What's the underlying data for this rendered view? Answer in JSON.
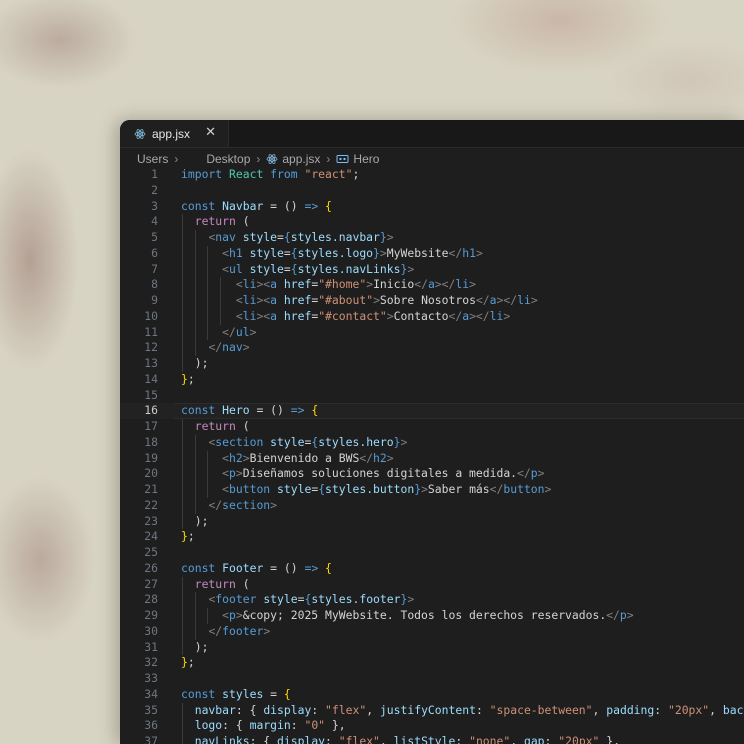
{
  "tab": {
    "filename": "app.jsx",
    "close_glyph": "✕"
  },
  "breadcrumb": [
    "Users",
    "Desktop",
    "app.jsx",
    "Hero"
  ],
  "active_line": 16,
  "colors": {
    "editor_bg": "#1e1e1e",
    "keyword": "#c586c0",
    "declaration": "#569cd6",
    "string": "#ce9178",
    "identifier": "#9cdcfe",
    "tag": "#569cd6",
    "bracket": "#ffd700"
  },
  "icons": {
    "tab": "react-icon",
    "breadcrumb_file": "react-icon",
    "breadcrumb_symbol": "symbol-variable-icon"
  },
  "lines": [
    [
      [
        "kw2",
        "import"
      ],
      [
        "plain",
        " "
      ],
      [
        "cls",
        "React"
      ],
      [
        "plain",
        " "
      ],
      [
        "kw2",
        "from"
      ],
      [
        "plain",
        " "
      ],
      [
        "str",
        "\"react\""
      ],
      [
        "plain",
        ";"
      ]
    ],
    [],
    [
      [
        "kw2",
        "const"
      ],
      [
        "plain",
        " "
      ],
      [
        "id",
        "Navbar"
      ],
      [
        "plain",
        " = () "
      ],
      [
        "kw2",
        "=>"
      ],
      [
        "plain",
        " "
      ],
      [
        "brace",
        "{"
      ]
    ],
    [
      [
        "plain",
        "  "
      ],
      [
        "kw",
        "return"
      ],
      [
        "plain",
        " ("
      ]
    ],
    [
      [
        "plain",
        "    "
      ],
      [
        "punc",
        "<"
      ],
      [
        "tag",
        "nav"
      ],
      [
        "plain",
        " "
      ],
      [
        "attr",
        "style"
      ],
      [
        "plain",
        "="
      ],
      [
        "kw2",
        "{"
      ],
      [
        "id",
        "styles.navbar"
      ],
      [
        "kw2",
        "}"
      ],
      [
        "punc",
        ">"
      ]
    ],
    [
      [
        "plain",
        "      "
      ],
      [
        "punc",
        "<"
      ],
      [
        "tag",
        "h1"
      ],
      [
        "plain",
        " "
      ],
      [
        "attr",
        "style"
      ],
      [
        "plain",
        "="
      ],
      [
        "kw2",
        "{"
      ],
      [
        "id",
        "styles.logo"
      ],
      [
        "kw2",
        "}"
      ],
      [
        "punc",
        ">"
      ],
      [
        "plain",
        "MyWebsite"
      ],
      [
        "punc",
        "</"
      ],
      [
        "tag",
        "h1"
      ],
      [
        "punc",
        ">"
      ]
    ],
    [
      [
        "plain",
        "      "
      ],
      [
        "punc",
        "<"
      ],
      [
        "tag",
        "ul"
      ],
      [
        "plain",
        " "
      ],
      [
        "attr",
        "style"
      ],
      [
        "plain",
        "="
      ],
      [
        "kw2",
        "{"
      ],
      [
        "id",
        "styles.navLinks"
      ],
      [
        "kw2",
        "}"
      ],
      [
        "punc",
        ">"
      ]
    ],
    [
      [
        "plain",
        "        "
      ],
      [
        "punc",
        "<"
      ],
      [
        "tag",
        "li"
      ],
      [
        "punc",
        "><"
      ],
      [
        "tag",
        "a"
      ],
      [
        "plain",
        " "
      ],
      [
        "attr",
        "href"
      ],
      [
        "plain",
        "="
      ],
      [
        "str",
        "\"#home\""
      ],
      [
        "punc",
        ">"
      ],
      [
        "plain",
        "Inicio"
      ],
      [
        "punc",
        "</"
      ],
      [
        "tag",
        "a"
      ],
      [
        "punc",
        "></"
      ],
      [
        "tag",
        "li"
      ],
      [
        "punc",
        ">"
      ]
    ],
    [
      [
        "plain",
        "        "
      ],
      [
        "punc",
        "<"
      ],
      [
        "tag",
        "li"
      ],
      [
        "punc",
        "><"
      ],
      [
        "tag",
        "a"
      ],
      [
        "plain",
        " "
      ],
      [
        "attr",
        "href"
      ],
      [
        "plain",
        "="
      ],
      [
        "str",
        "\"#about\""
      ],
      [
        "punc",
        ">"
      ],
      [
        "plain",
        "Sobre Nosotros"
      ],
      [
        "punc",
        "</"
      ],
      [
        "tag",
        "a"
      ],
      [
        "punc",
        "></"
      ],
      [
        "tag",
        "li"
      ],
      [
        "punc",
        ">"
      ]
    ],
    [
      [
        "plain",
        "        "
      ],
      [
        "punc",
        "<"
      ],
      [
        "tag",
        "li"
      ],
      [
        "punc",
        "><"
      ],
      [
        "tag",
        "a"
      ],
      [
        "plain",
        " "
      ],
      [
        "attr",
        "href"
      ],
      [
        "plain",
        "="
      ],
      [
        "str",
        "\"#contact\""
      ],
      [
        "punc",
        ">"
      ],
      [
        "plain",
        "Contacto"
      ],
      [
        "punc",
        "</"
      ],
      [
        "tag",
        "a"
      ],
      [
        "punc",
        "></"
      ],
      [
        "tag",
        "li"
      ],
      [
        "punc",
        ">"
      ]
    ],
    [
      [
        "plain",
        "      "
      ],
      [
        "punc",
        "</"
      ],
      [
        "tag",
        "ul"
      ],
      [
        "punc",
        ">"
      ]
    ],
    [
      [
        "plain",
        "    "
      ],
      [
        "punc",
        "</"
      ],
      [
        "tag",
        "nav"
      ],
      [
        "punc",
        ">"
      ]
    ],
    [
      [
        "plain",
        "  );"
      ]
    ],
    [
      [
        "brace",
        "}"
      ],
      [
        "plain",
        ";"
      ]
    ],
    [],
    [
      [
        "kw2",
        "const"
      ],
      [
        "plain",
        " "
      ],
      [
        "id",
        "Hero"
      ],
      [
        "plain",
        " = () "
      ],
      [
        "kw2",
        "=>"
      ],
      [
        "plain",
        " "
      ],
      [
        "brace",
        "{"
      ]
    ],
    [
      [
        "plain",
        "  "
      ],
      [
        "kw",
        "return"
      ],
      [
        "plain",
        " ("
      ]
    ],
    [
      [
        "plain",
        "    "
      ],
      [
        "punc",
        "<"
      ],
      [
        "tag",
        "section"
      ],
      [
        "plain",
        " "
      ],
      [
        "attr",
        "style"
      ],
      [
        "plain",
        "="
      ],
      [
        "kw2",
        "{"
      ],
      [
        "id",
        "styles.hero"
      ],
      [
        "kw2",
        "}"
      ],
      [
        "punc",
        ">"
      ]
    ],
    [
      [
        "plain",
        "      "
      ],
      [
        "punc",
        "<"
      ],
      [
        "tag",
        "h2"
      ],
      [
        "punc",
        ">"
      ],
      [
        "plain",
        "Bienvenido a BWS"
      ],
      [
        "punc",
        "</"
      ],
      [
        "tag",
        "h2"
      ],
      [
        "punc",
        ">"
      ]
    ],
    [
      [
        "plain",
        "      "
      ],
      [
        "punc",
        "<"
      ],
      [
        "tag",
        "p"
      ],
      [
        "punc",
        ">"
      ],
      [
        "plain",
        "Diseñamos soluciones digitales a medida."
      ],
      [
        "punc",
        "</"
      ],
      [
        "tag",
        "p"
      ],
      [
        "punc",
        ">"
      ]
    ],
    [
      [
        "plain",
        "      "
      ],
      [
        "punc",
        "<"
      ],
      [
        "tag",
        "button"
      ],
      [
        "plain",
        " "
      ],
      [
        "attr",
        "style"
      ],
      [
        "plain",
        "="
      ],
      [
        "kw2",
        "{"
      ],
      [
        "id",
        "styles.button"
      ],
      [
        "kw2",
        "}"
      ],
      [
        "punc",
        ">"
      ],
      [
        "plain",
        "Saber más"
      ],
      [
        "punc",
        "</"
      ],
      [
        "tag",
        "button"
      ],
      [
        "punc",
        ">"
      ]
    ],
    [
      [
        "plain",
        "    "
      ],
      [
        "punc",
        "</"
      ],
      [
        "tag",
        "section"
      ],
      [
        "punc",
        ">"
      ]
    ],
    [
      [
        "plain",
        "  );"
      ]
    ],
    [
      [
        "brace",
        "}"
      ],
      [
        "plain",
        ";"
      ]
    ],
    [],
    [
      [
        "kw2",
        "const"
      ],
      [
        "plain",
        " "
      ],
      [
        "id",
        "Footer"
      ],
      [
        "plain",
        " = () "
      ],
      [
        "kw2",
        "=>"
      ],
      [
        "plain",
        " "
      ],
      [
        "brace",
        "{"
      ]
    ],
    [
      [
        "plain",
        "  "
      ],
      [
        "kw",
        "return"
      ],
      [
        "plain",
        " ("
      ]
    ],
    [
      [
        "plain",
        "    "
      ],
      [
        "punc",
        "<"
      ],
      [
        "tag",
        "footer"
      ],
      [
        "plain",
        " "
      ],
      [
        "attr",
        "style"
      ],
      [
        "plain",
        "="
      ],
      [
        "kw2",
        "{"
      ],
      [
        "id",
        "styles.footer"
      ],
      [
        "kw2",
        "}"
      ],
      [
        "punc",
        ">"
      ]
    ],
    [
      [
        "plain",
        "      "
      ],
      [
        "punc",
        "<"
      ],
      [
        "tag",
        "p"
      ],
      [
        "punc",
        ">"
      ],
      [
        "plain",
        "&copy; 2025 MyWebsite. Todos los derechos reservados."
      ],
      [
        "punc",
        "</"
      ],
      [
        "tag",
        "p"
      ],
      [
        "punc",
        ">"
      ]
    ],
    [
      [
        "plain",
        "    "
      ],
      [
        "punc",
        "</"
      ],
      [
        "tag",
        "footer"
      ],
      [
        "punc",
        ">"
      ]
    ],
    [
      [
        "plain",
        "  );"
      ]
    ],
    [
      [
        "brace",
        "}"
      ],
      [
        "plain",
        ";"
      ]
    ],
    [],
    [
      [
        "kw2",
        "const"
      ],
      [
        "plain",
        " "
      ],
      [
        "id",
        "styles"
      ],
      [
        "plain",
        " = "
      ],
      [
        "brace",
        "{"
      ]
    ],
    [
      [
        "plain",
        "  "
      ],
      [
        "id",
        "navbar"
      ],
      [
        "plain",
        ": { "
      ],
      [
        "id",
        "display"
      ],
      [
        "plain",
        ": "
      ],
      [
        "str",
        "\"flex\""
      ],
      [
        "plain",
        ", "
      ],
      [
        "id",
        "justifyContent"
      ],
      [
        "plain",
        ": "
      ],
      [
        "str",
        "\"space-between\""
      ],
      [
        "plain",
        ", "
      ],
      [
        "id",
        "padding"
      ],
      [
        "plain",
        ": "
      ],
      [
        "str",
        "\"20px\""
      ],
      [
        "plain",
        ", "
      ],
      [
        "id",
        "backgroundColor"
      ]
    ],
    [
      [
        "plain",
        "  "
      ],
      [
        "id",
        "logo"
      ],
      [
        "plain",
        ": { "
      ],
      [
        "id",
        "margin"
      ],
      [
        "plain",
        ": "
      ],
      [
        "str",
        "\"0\""
      ],
      [
        "plain",
        " },"
      ]
    ],
    [
      [
        "plain",
        "  "
      ],
      [
        "id",
        "navLinks"
      ],
      [
        "plain",
        ": { "
      ],
      [
        "id",
        "display"
      ],
      [
        "plain",
        ": "
      ],
      [
        "str",
        "\"flex\""
      ],
      [
        "plain",
        ", "
      ],
      [
        "id",
        "listStyle"
      ],
      [
        "plain",
        ": "
      ],
      [
        "str",
        "\"none\""
      ],
      [
        "plain",
        ", "
      ],
      [
        "id",
        "gap"
      ],
      [
        "plain",
        ": "
      ],
      [
        "str",
        "\"20px\""
      ],
      [
        "plain",
        " },"
      ]
    ]
  ]
}
